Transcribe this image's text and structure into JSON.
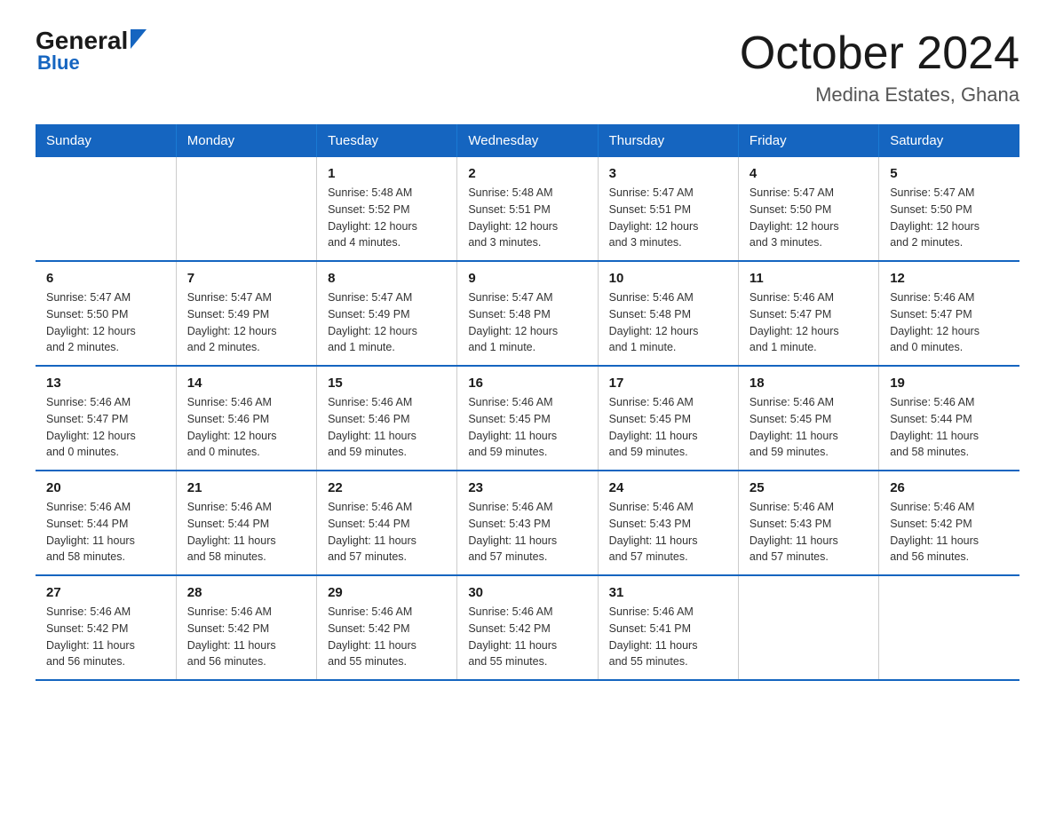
{
  "logo": {
    "general": "General",
    "blue": "Blue",
    "arrow": "▲"
  },
  "title": "October 2024",
  "subtitle": "Medina Estates, Ghana",
  "days_of_week": [
    "Sunday",
    "Monday",
    "Tuesday",
    "Wednesday",
    "Thursday",
    "Friday",
    "Saturday"
  ],
  "weeks": [
    [
      {
        "day": "",
        "info": ""
      },
      {
        "day": "",
        "info": ""
      },
      {
        "day": "1",
        "info": "Sunrise: 5:48 AM\nSunset: 5:52 PM\nDaylight: 12 hours\nand 4 minutes."
      },
      {
        "day": "2",
        "info": "Sunrise: 5:48 AM\nSunset: 5:51 PM\nDaylight: 12 hours\nand 3 minutes."
      },
      {
        "day": "3",
        "info": "Sunrise: 5:47 AM\nSunset: 5:51 PM\nDaylight: 12 hours\nand 3 minutes."
      },
      {
        "day": "4",
        "info": "Sunrise: 5:47 AM\nSunset: 5:50 PM\nDaylight: 12 hours\nand 3 minutes."
      },
      {
        "day": "5",
        "info": "Sunrise: 5:47 AM\nSunset: 5:50 PM\nDaylight: 12 hours\nand 2 minutes."
      }
    ],
    [
      {
        "day": "6",
        "info": "Sunrise: 5:47 AM\nSunset: 5:50 PM\nDaylight: 12 hours\nand 2 minutes."
      },
      {
        "day": "7",
        "info": "Sunrise: 5:47 AM\nSunset: 5:49 PM\nDaylight: 12 hours\nand 2 minutes."
      },
      {
        "day": "8",
        "info": "Sunrise: 5:47 AM\nSunset: 5:49 PM\nDaylight: 12 hours\nand 1 minute."
      },
      {
        "day": "9",
        "info": "Sunrise: 5:47 AM\nSunset: 5:48 PM\nDaylight: 12 hours\nand 1 minute."
      },
      {
        "day": "10",
        "info": "Sunrise: 5:46 AM\nSunset: 5:48 PM\nDaylight: 12 hours\nand 1 minute."
      },
      {
        "day": "11",
        "info": "Sunrise: 5:46 AM\nSunset: 5:47 PM\nDaylight: 12 hours\nand 1 minute."
      },
      {
        "day": "12",
        "info": "Sunrise: 5:46 AM\nSunset: 5:47 PM\nDaylight: 12 hours\nand 0 minutes."
      }
    ],
    [
      {
        "day": "13",
        "info": "Sunrise: 5:46 AM\nSunset: 5:47 PM\nDaylight: 12 hours\nand 0 minutes."
      },
      {
        "day": "14",
        "info": "Sunrise: 5:46 AM\nSunset: 5:46 PM\nDaylight: 12 hours\nand 0 minutes."
      },
      {
        "day": "15",
        "info": "Sunrise: 5:46 AM\nSunset: 5:46 PM\nDaylight: 11 hours\nand 59 minutes."
      },
      {
        "day": "16",
        "info": "Sunrise: 5:46 AM\nSunset: 5:45 PM\nDaylight: 11 hours\nand 59 minutes."
      },
      {
        "day": "17",
        "info": "Sunrise: 5:46 AM\nSunset: 5:45 PM\nDaylight: 11 hours\nand 59 minutes."
      },
      {
        "day": "18",
        "info": "Sunrise: 5:46 AM\nSunset: 5:45 PM\nDaylight: 11 hours\nand 59 minutes."
      },
      {
        "day": "19",
        "info": "Sunrise: 5:46 AM\nSunset: 5:44 PM\nDaylight: 11 hours\nand 58 minutes."
      }
    ],
    [
      {
        "day": "20",
        "info": "Sunrise: 5:46 AM\nSunset: 5:44 PM\nDaylight: 11 hours\nand 58 minutes."
      },
      {
        "day": "21",
        "info": "Sunrise: 5:46 AM\nSunset: 5:44 PM\nDaylight: 11 hours\nand 58 minutes."
      },
      {
        "day": "22",
        "info": "Sunrise: 5:46 AM\nSunset: 5:44 PM\nDaylight: 11 hours\nand 57 minutes."
      },
      {
        "day": "23",
        "info": "Sunrise: 5:46 AM\nSunset: 5:43 PM\nDaylight: 11 hours\nand 57 minutes."
      },
      {
        "day": "24",
        "info": "Sunrise: 5:46 AM\nSunset: 5:43 PM\nDaylight: 11 hours\nand 57 minutes."
      },
      {
        "day": "25",
        "info": "Sunrise: 5:46 AM\nSunset: 5:43 PM\nDaylight: 11 hours\nand 57 minutes."
      },
      {
        "day": "26",
        "info": "Sunrise: 5:46 AM\nSunset: 5:42 PM\nDaylight: 11 hours\nand 56 minutes."
      }
    ],
    [
      {
        "day": "27",
        "info": "Sunrise: 5:46 AM\nSunset: 5:42 PM\nDaylight: 11 hours\nand 56 minutes."
      },
      {
        "day": "28",
        "info": "Sunrise: 5:46 AM\nSunset: 5:42 PM\nDaylight: 11 hours\nand 56 minutes."
      },
      {
        "day": "29",
        "info": "Sunrise: 5:46 AM\nSunset: 5:42 PM\nDaylight: 11 hours\nand 55 minutes."
      },
      {
        "day": "30",
        "info": "Sunrise: 5:46 AM\nSunset: 5:42 PM\nDaylight: 11 hours\nand 55 minutes."
      },
      {
        "day": "31",
        "info": "Sunrise: 5:46 AM\nSunset: 5:41 PM\nDaylight: 11 hours\nand 55 minutes."
      },
      {
        "day": "",
        "info": ""
      },
      {
        "day": "",
        "info": ""
      }
    ]
  ]
}
